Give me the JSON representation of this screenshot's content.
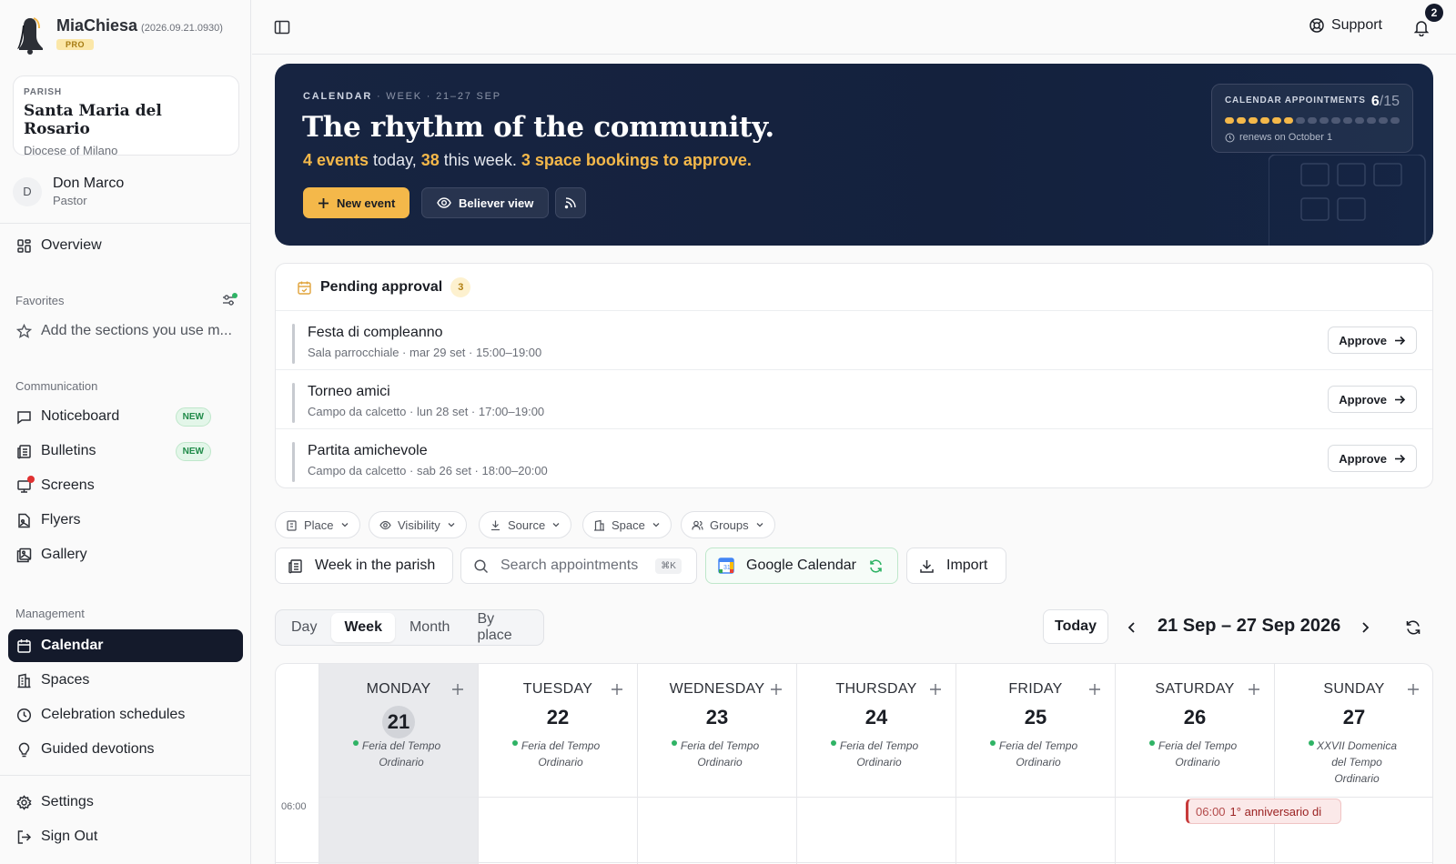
{
  "app": {
    "name": "MiaChiesa",
    "version": "(2026.09.21.0930)",
    "plan": "PRO"
  },
  "parish": {
    "label": "PARISH",
    "name": "Santa Maria del Rosario",
    "diocese": "Diocese of Milano"
  },
  "user": {
    "initial": "D",
    "name": "Don Marco",
    "role": "Pastor"
  },
  "sidebar": {
    "overview": "Overview",
    "favorites": {
      "label": "Favorites",
      "placeholder": "Add the sections you use m..."
    },
    "communication": {
      "label": "Communication",
      "items": [
        {
          "label": "Noticeboard",
          "badge": "NEW"
        },
        {
          "label": "Bulletins",
          "badge": "NEW"
        },
        {
          "label": "Screens"
        },
        {
          "label": "Flyers"
        },
        {
          "label": "Gallery"
        }
      ]
    },
    "management": {
      "label": "Management",
      "items": [
        {
          "label": "Calendar",
          "active": true
        },
        {
          "label": "Spaces"
        },
        {
          "label": "Celebration schedules"
        },
        {
          "label": "Guided devotions"
        }
      ]
    },
    "settings": "Settings",
    "sign_out": "Sign Out"
  },
  "topbar": {
    "support": "Support",
    "notifications": "2"
  },
  "hero": {
    "eyebrow": "CALENDAR",
    "eyebrow_sub": "· WEEK · 21–27 SEP",
    "title": "The rhythm of the community.",
    "events_today": "4 events",
    "today_text": " today, ",
    "events_week": "38",
    "week_text": " this week. ",
    "bookings": "3 space bookings to approve.",
    "new_event": "New event",
    "believer_view": "Believer view",
    "appointments_label": "CALENDAR APPOINTMENTS",
    "appointments_used": "6",
    "appointments_total": "/15",
    "appointments_fraction": 0.4,
    "renews": "renews on October 1"
  },
  "pending": {
    "title": "Pending approval",
    "count": "3",
    "approve_label": "Approve",
    "items": [
      {
        "title": "Festa di compleanno",
        "meta": "Sala parrocchiale · mar 29 set · 15:00–19:00"
      },
      {
        "title": "Torneo amici",
        "meta": "Campo da calcetto · lun 28 set · 17:00–19:00"
      },
      {
        "title": "Partita amichevole",
        "meta": "Campo da calcetto · sab 26 set · 18:00–20:00"
      }
    ]
  },
  "filters": [
    "Place",
    "Visibility",
    "Source",
    "Space",
    "Groups"
  ],
  "tools": {
    "week_parish": "Week in the parish",
    "search_placeholder": "Search appointments",
    "shortcut": "⌘K",
    "google": "Google Calendar",
    "import": "Import"
  },
  "views": [
    "Day",
    "Week",
    "Month",
    "By place"
  ],
  "active_view": "Week",
  "nav": {
    "today": "Today",
    "range": "21 Sep – 27 Sep 2026"
  },
  "calendar": {
    "first_hour": "06:00",
    "days": [
      {
        "name": "MONDAY",
        "num": "21",
        "liturgy": "Feria del Tempo Ordinario",
        "today": true
      },
      {
        "name": "TUESDAY",
        "num": "22",
        "liturgy": "Feria del Tempo Ordinario"
      },
      {
        "name": "WEDNESDAY",
        "num": "23",
        "liturgy": "Feria del Tempo Ordinario"
      },
      {
        "name": "THURSDAY",
        "num": "24",
        "liturgy": "Feria del Tempo Ordinario"
      },
      {
        "name": "FRIDAY",
        "num": "25",
        "liturgy": "Feria del Tempo Ordinario"
      },
      {
        "name": "SATURDAY",
        "num": "26",
        "liturgy": "Feria del Tempo Ordinario"
      },
      {
        "name": "SUNDAY",
        "num": "27",
        "liturgy": "XXVII Domenica del Tempo Ordinario"
      }
    ],
    "event": {
      "time": "06:00",
      "title": "1° anniversario di"
    }
  },
  "colors": {
    "accent": "#f4b84a",
    "navy": "#14213d",
    "active_nav": "#141a2b",
    "success": "#2fb365",
    "event": "#c73a3a"
  }
}
